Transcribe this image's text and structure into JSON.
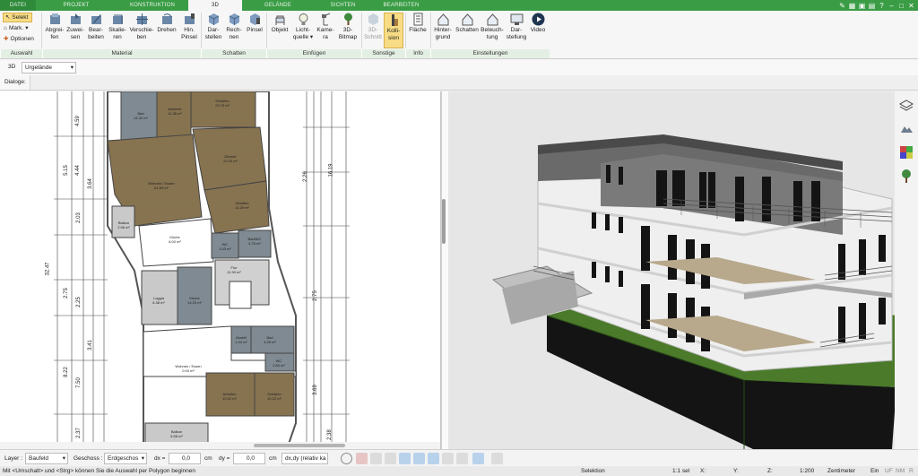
{
  "tabs": [
    "DATEI",
    "PROJEKT",
    "KONSTRUKTION",
    "3D",
    "GELÄNDE",
    "SICHTEN",
    "BEARBEITEN"
  ],
  "active_tab": "3D",
  "ribbon": {
    "selekt": "Selekt",
    "mark": "Mark.",
    "optionen": "Optionen",
    "buttons": [
      {
        "l1": "Abgrei-",
        "l2": "fen"
      },
      {
        "l1": "Zuwei-",
        "l2": "sen"
      },
      {
        "l1": "Bear-",
        "l2": "beiten"
      },
      {
        "l1": "Skalie-",
        "l2": "ren"
      },
      {
        "l1": "Verschie-",
        "l2": "ben"
      },
      {
        "l1": "Drehen",
        "l2": ""
      },
      {
        "l1": "Hin.",
        "l2": "Pinsel"
      },
      {
        "l1": "Dar-",
        "l2": "stellen"
      },
      {
        "l1": "Rech-",
        "l2": "nen"
      },
      {
        "l1": "Pinsel",
        "l2": ""
      },
      {
        "l1": "Objekt",
        "l2": ""
      },
      {
        "l1": "Licht-",
        "l2": "quelle ▾"
      },
      {
        "l1": "Kame-",
        "l2": "ra"
      },
      {
        "l1": "3D-",
        "l2": "Bitmap"
      },
      {
        "l1": "3D-",
        "l2": "Schnitt"
      },
      {
        "l1": "Kolli-",
        "l2": "sion"
      },
      {
        "l1": "Fläche",
        "l2": ""
      },
      {
        "l1": "Hinter-",
        "l2": "grund"
      },
      {
        "l1": "Schatten",
        "l2": ""
      },
      {
        "l1": "Beleuch-",
        "l2": "tung"
      },
      {
        "l1": "Dar-",
        "l2": "stellung"
      },
      {
        "l1": "Video",
        "l2": ""
      }
    ],
    "groups": [
      "Auswahl",
      "Material",
      "Schatten",
      "Einfügen",
      "Sonstige",
      "Info",
      "Einstellungen"
    ]
  },
  "viewbar": {
    "mode": "3D",
    "terrain": "Urgelände"
  },
  "dialoge": "Dialoge:",
  "plan_dims": {
    "left": "32.47",
    "d1": "5.15",
    "d2": "4.44",
    "d3": "4.59",
    "d4": "3.64",
    "d5": "2.03",
    "d6": "2.75",
    "d7": "2.25",
    "d8": "3.41",
    "d9": "8.22",
    "d10": "7.50",
    "d11": "2.37",
    "r1": "16.19",
    "r2": "2.26",
    "r3": "2.75",
    "r4": "3.69",
    "r5": "2.38"
  },
  "rooms": [
    {
      "n": "Bad",
      "a": "14.32 m²"
    },
    {
      "n": "Ankleide",
      "a": "11.38 m²"
    },
    {
      "n": "Schlafen",
      "a": "23.79 m²"
    },
    {
      "n": "Wohnen / Essen",
      "a": "51.89 m²"
    },
    {
      "n": "Zimmer",
      "a": "22.03 m²"
    },
    {
      "n": "Arbeiten",
      "a": "14.29 m²"
    },
    {
      "n": "Balkon",
      "a": "2.96 m²"
    },
    {
      "n": "Küche",
      "a": "6.00 m²"
    },
    {
      "n": "WC",
      "a": "3.43 m²"
    },
    {
      "n": "Bad/WC",
      "a": "4.76 m²"
    },
    {
      "n": "Flur",
      "a": "11.90 m²"
    },
    {
      "n": "Loggia",
      "a": "6.38 m²"
    },
    {
      "n": "Küche",
      "a": "14.29 m²"
    },
    {
      "n": "Abstell",
      "a": "1.04 m²"
    },
    {
      "n": "Bad",
      "a": "4.25 m²"
    },
    {
      "n": "WC",
      "a": "2.60 m²"
    },
    {
      "n": "Wohnen / Essen",
      "a": "0.00 m²"
    },
    {
      "n": "Arbeiten",
      "a": "10.92 m²"
    },
    {
      "n": "Schlafen",
      "a": "10.22 m²"
    },
    {
      "n": "Balkon",
      "a": "5.58 m²"
    }
  ],
  "status": {
    "layer_label": "Layer :",
    "layer": "Baufeld",
    "geschoss_label": "Geschoss :",
    "geschoss": "Erdgeschos",
    "dx_label": "dx =",
    "dx": "0,0",
    "cm1": "cm",
    "dy_label": "dy =",
    "dy": "0,0",
    "cm2": "cm",
    "mode": "dx,dy (relativ ka",
    "hint": "Mit <Umschalt> und <Strg> können Sie die Auswahl per Polygon beginnen",
    "selektion": "Selektion",
    "sel": "1:1 sel",
    "x": "X:",
    "y": "Y:",
    "z": "Z:",
    "scale": "1:200",
    "unit": "Zentimeter",
    "ein": "Ein",
    "uf": "UF",
    "nm": "NM",
    "r": "R"
  },
  "colors": {
    "green": "#3a9c45",
    "grass": "#4a7a2a"
  }
}
